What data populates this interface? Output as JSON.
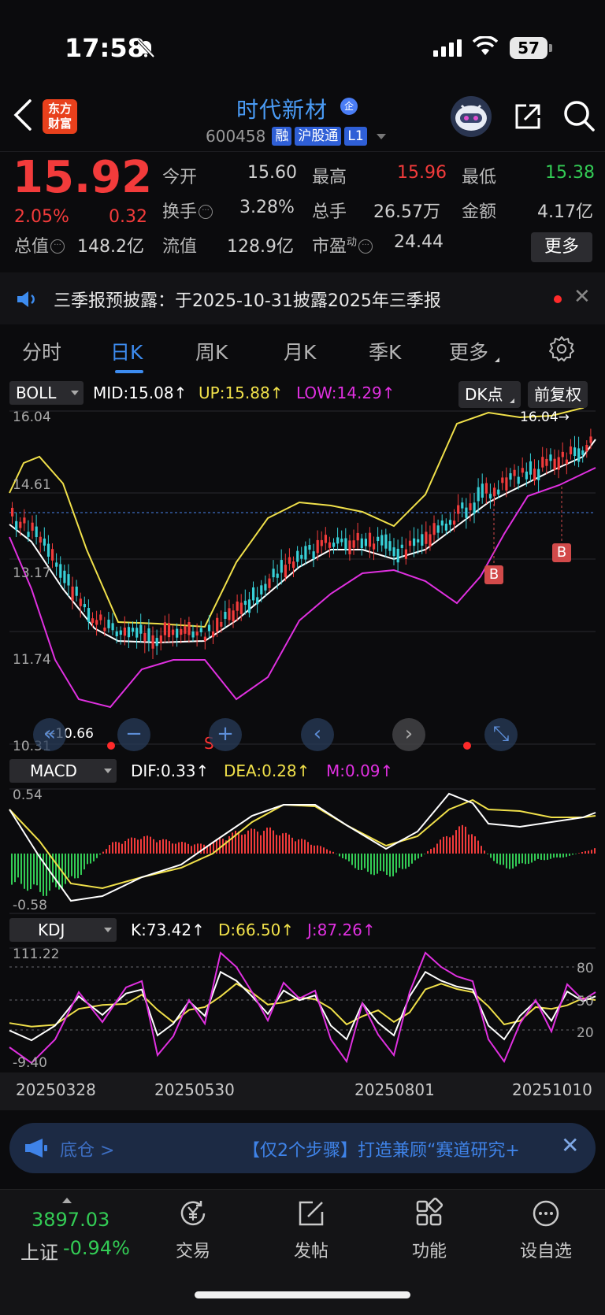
{
  "status_bar": {
    "time": "17:58",
    "battery": "57"
  },
  "header": {
    "logo_line1": "东方",
    "logo_line2": "财富",
    "stock_name": "时代新材",
    "name_badge": "企",
    "stock_code": "600458",
    "tags": [
      "融",
      "沪股通",
      "L1"
    ]
  },
  "quote": {
    "price": "15.92",
    "change_pct": "2.05%",
    "change_abs": "0.32",
    "fields": {
      "open_label": "今开",
      "open": "15.60",
      "high_label": "最高",
      "high": "15.96",
      "low_label": "最低",
      "low": "15.38",
      "turnover_label": "换手",
      "turnover": "3.28%",
      "volume_label": "总手",
      "volume": "26.57万",
      "amount_label": "金额",
      "amount": "4.17亿",
      "mktcap_label": "总值",
      "mktcap": "148.2亿",
      "float_label": "流值",
      "float": "128.9亿",
      "pe_label": "市盈",
      "pe_sup": "动",
      "pe": "24.44"
    },
    "more_label": "更多"
  },
  "notice": {
    "text": "三季报预披露：于2025-10-31披露2025年三季报",
    "close": "✕"
  },
  "tabs": {
    "items": [
      "分时",
      "日K",
      "周K",
      "月K",
      "季K",
      "更多"
    ],
    "active": 1
  },
  "boll": {
    "name": "BOLL",
    "mid": "MID:15.08",
    "up": "UP:15.88",
    "low": "LOW:14.29",
    "dk_label": "DK点",
    "adj_label": "前复权",
    "y_labels": [
      "16.04",
      "14.61",
      "13.17",
      "11.74",
      "10.31"
    ],
    "max_label": "16.04→",
    "min_label": "←10.66",
    "buy_mark": "B",
    "sell_mark": "S"
  },
  "macd": {
    "name": "MACD",
    "dif": "DIF:0.33",
    "dea": "DEA:0.28",
    "m": "M:0.09",
    "y_labels": [
      "0.54",
      "-0.58"
    ]
  },
  "kdj": {
    "name": "KDJ",
    "k": "K:73.42",
    "d": "D:66.50",
    "j": "J:87.26",
    "y_labels": [
      "111.22",
      "-9.40"
    ],
    "ref_labels": [
      "80",
      "50",
      "20"
    ]
  },
  "date_axis": [
    "20250328",
    "20250530",
    "20250801",
    "20251010"
  ],
  "banner": {
    "left": "底仓 >",
    "text": "【仅2个步骤】打造兼顾“赛道研究+"
  },
  "bottom_nav": {
    "index_value": "3897.03",
    "index_name": "上证",
    "index_change": "-0.94%",
    "items": [
      "交易",
      "发帖",
      "功能",
      "设自选"
    ]
  },
  "colors": {
    "up": "#f23b3b",
    "down": "#33cc55",
    "accent": "#3d8cf0",
    "boll_up": "#f0e04a",
    "boll_low": "#e030e0"
  }
}
